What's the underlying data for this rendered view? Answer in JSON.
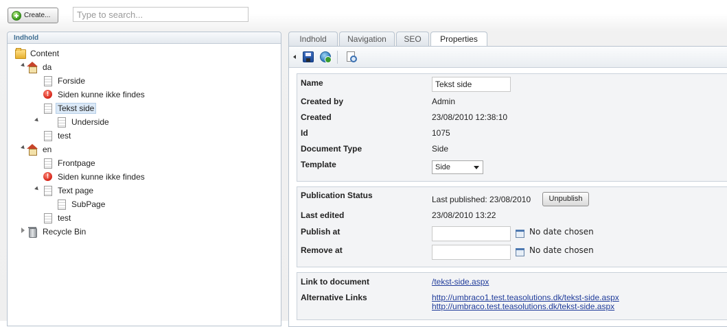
{
  "toolbar": {
    "create_label": "Create...",
    "search_placeholder": "Type to search..."
  },
  "tree": {
    "header": "Indhold",
    "items": [
      {
        "label": "Content",
        "icon": "folder-icon"
      },
      {
        "label": "da",
        "icon": "home-icon"
      },
      {
        "label": "Forside",
        "icon": "doc-icon"
      },
      {
        "label": "Siden kunne ikke findes",
        "icon": "error-icon"
      },
      {
        "label": "Tekst side",
        "icon": "doc-icon",
        "selected": true
      },
      {
        "label": "Underside",
        "icon": "doc-icon"
      },
      {
        "label": "test",
        "icon": "doc-icon"
      },
      {
        "label": "en",
        "icon": "home-icon"
      },
      {
        "label": "Frontpage",
        "icon": "doc-icon"
      },
      {
        "label": "Siden kunne ikke findes",
        "icon": "error-icon"
      },
      {
        "label": "Text page",
        "icon": "doc-icon"
      },
      {
        "label": "SubPage",
        "icon": "doc-icon"
      },
      {
        "label": "test",
        "icon": "doc-icon"
      },
      {
        "label": "Recycle Bin",
        "icon": "bin-icon"
      }
    ]
  },
  "tabs": [
    {
      "label": "Indhold"
    },
    {
      "label": "Navigation"
    },
    {
      "label": "SEO"
    },
    {
      "label": "Properties",
      "active": true
    }
  ],
  "properties": {
    "name_label": "Name",
    "name_value": "Tekst side",
    "created_by_label": "Created by",
    "created_by_value": "Admin",
    "created_label": "Created",
    "created_value": "23/08/2010 12:38:10",
    "id_label": "Id",
    "id_value": "1075",
    "doctype_label": "Document Type",
    "doctype_value": "Side",
    "template_label": "Template",
    "template_value": "Side"
  },
  "publication": {
    "status_label": "Publication Status",
    "last_published": "Last published: 23/08/2010",
    "unpublish_label": "Unpublish",
    "last_edited_label": "Last edited",
    "last_edited_value": "23/08/2010 13:22",
    "publish_at_label": "Publish at",
    "publish_at_value": "No date chosen",
    "remove_at_label": "Remove at",
    "remove_at_value": "No date chosen"
  },
  "links": {
    "link_label": "Link to document",
    "link_value": "/tekst-side.aspx",
    "alt_label": "Alternative Links",
    "alt_values": [
      "http://umbraco1.test.teasolutions.dk/tekst-side.aspx",
      "http://umbraco.test.teasolutions.dk/tekst-side.aspx"
    ]
  }
}
